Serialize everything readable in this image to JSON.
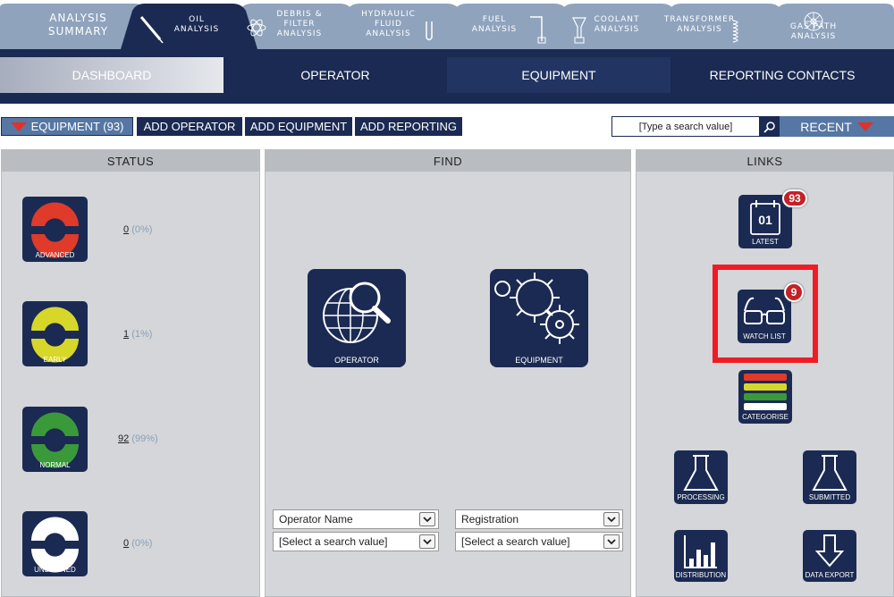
{
  "tabs": [
    {
      "line1": "ANALYSIS",
      "line2": "SUMMARY"
    },
    {
      "line1": "OIL",
      "line2": "ANALYSIS"
    },
    {
      "line1": "DEBRIS & FILTER",
      "line2": "ANALYSIS"
    },
    {
      "line1": "HYDRAULIC",
      "line2": "FLUID ANALYSIS"
    },
    {
      "line1": "FUEL",
      "line2": "ANALYSIS"
    },
    {
      "line1": "COOLANT",
      "line2": "ANALYSIS"
    },
    {
      "line1": "TRANSFORMER",
      "line2": "ANALYSIS"
    },
    {
      "line1": "",
      "line2": "GAS PATH ANALYSIS"
    }
  ],
  "nav": [
    "DASHBOARD",
    "OPERATOR",
    "EQUIPMENT",
    "REPORTING CONTACTS"
  ],
  "actions": {
    "equipment": "EQUIPMENT (93)",
    "add_operator": "ADD OPERATOR",
    "add_equipment": "ADD EQUIPMENT",
    "add_reporting": "ADD REPORTING",
    "search_placeholder": "[Type a search value]",
    "recent": "RECENT"
  },
  "status": {
    "title": "STATUS",
    "items": [
      {
        "label": "ADVANCED",
        "count": "0",
        "pct": "(0%)",
        "color": "#e03a2a"
      },
      {
        "label": "EARLY",
        "count": "1",
        "pct": "(1%)",
        "color": "#d7d72a"
      },
      {
        "label": "NORMAL",
        "count": "92",
        "pct": "(99%)",
        "color": "#3a9a3a"
      },
      {
        "label": "UNDEFINED",
        "count": "0",
        "pct": "(0%)",
        "color": "#ffffff"
      }
    ]
  },
  "find": {
    "title": "FIND",
    "operator_label": "OPERATOR",
    "equipment_label": "EQUIPMENT",
    "sel1": "Operator Name",
    "sel2": "[Select a search value]",
    "sel3": "Registration",
    "sel4": "[Select a search value]"
  },
  "links": {
    "title": "LINKS",
    "latest": "LATEST",
    "latest_date": "01",
    "latest_badge": "93",
    "watch": "WATCH LIST",
    "watch_badge": "9",
    "categorise": "CATEGORISE",
    "processing": "PROCESSING",
    "submitted": "SUBMITTED",
    "distribution": "DISTRIBUTION",
    "export": "DATA EXPORT"
  },
  "colors": {
    "navy": "#1b2a52",
    "tab": "#8fa3bd",
    "accent": "#e0322a"
  }
}
